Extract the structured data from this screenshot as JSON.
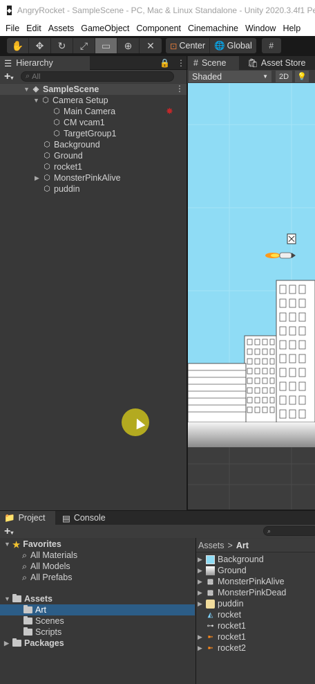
{
  "window": {
    "title": "AngryRocket - SampleScene - PC, Mac & Linux Standalone - Unity 2020.3.4f1 Pers"
  },
  "menu": [
    "File",
    "Edit",
    "Assets",
    "GameObject",
    "Component",
    "Cinemachine",
    "Window",
    "Help"
  ],
  "toolbar": {
    "tools": [
      "hand-tool-icon",
      "move-tool-icon",
      "rotate-tool-icon",
      "scale-tool-icon",
      "rect-tool-icon",
      "transform-tool-icon",
      "custom-tool-icon"
    ],
    "active_tool": "rect-tool-icon",
    "pivot_label": "Center",
    "space_label": "Global"
  },
  "hierarchy": {
    "tab_label": "Hierarchy",
    "search_placeholder": "All",
    "scene_name": "SampleScene",
    "items": [
      {
        "label": "Camera Setup",
        "depth": 1,
        "expanded": true
      },
      {
        "label": "Main Camera",
        "depth": 2
      },
      {
        "label": "CM vcam1",
        "depth": 2
      },
      {
        "label": "TargetGroup1",
        "depth": 2
      },
      {
        "label": "Background",
        "depth": 1
      },
      {
        "label": "Ground",
        "depth": 1
      },
      {
        "label": "rocket1",
        "depth": 1
      },
      {
        "label": "MonsterPinkAlive",
        "depth": 1,
        "collapsed": true
      },
      {
        "label": "puddin",
        "depth": 1
      }
    ]
  },
  "scene": {
    "tab_label": "Scene",
    "asset_store_label": "Asset Store",
    "shading_mode": "Shaded",
    "mode_2d": "2D"
  },
  "project": {
    "tab_label": "Project",
    "console_label": "Console",
    "favorites_label": "Favorites",
    "favorites": [
      "All Materials",
      "All Models",
      "All Prefabs"
    ],
    "assets_label": "Assets",
    "asset_folders": [
      "Art",
      "Scenes",
      "Scripts"
    ],
    "selected_folder": "Art",
    "packages_label": "Packages",
    "breadcrumb": [
      "Assets",
      "Art"
    ],
    "art_items": [
      {
        "label": "Background",
        "icon": "sky-sprite-icon",
        "expandable": true
      },
      {
        "label": "Ground",
        "icon": "ground-sprite-icon",
        "expandable": true
      },
      {
        "label": "MonsterPinkAlive",
        "icon": "monster-sprite-icon",
        "expandable": true
      },
      {
        "label": "MonsterPinkDead",
        "icon": "monster-sprite-icon",
        "expandable": true
      },
      {
        "label": "puddin",
        "icon": "puddin-sprite-icon",
        "expandable": true
      },
      {
        "label": "rocket",
        "icon": "animation-icon",
        "expandable": false
      },
      {
        "label": "rocket1",
        "icon": "animator-icon",
        "expandable": false
      },
      {
        "label": "rocket1",
        "icon": "rocket-sprite-icon",
        "expandable": true
      },
      {
        "label": "rocket2",
        "icon": "rocket-sprite-icon",
        "expandable": true
      }
    ]
  },
  "colors": {
    "sky": "#8fdcf5",
    "selection": "#2c5d87",
    "cursor_highlight": "#c4ba1c",
    "panel": "#383838"
  }
}
